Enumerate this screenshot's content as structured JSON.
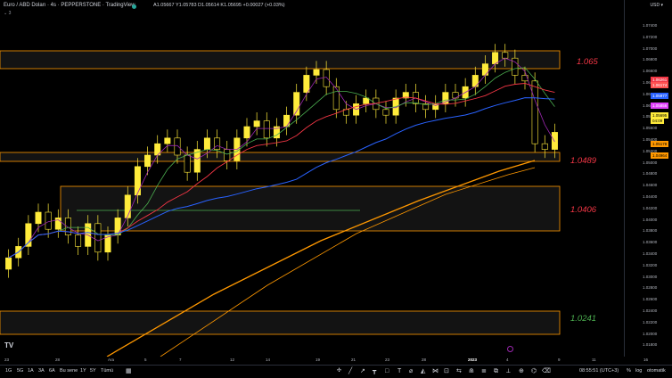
{
  "header": {
    "title": "Euro / ABD Doları · 4s · PEPPERSTONE · TradingView",
    "ohlc": "A1.05667  Y1.05783  D1.05614  K1.05695  +0.00027 (+0.03%)",
    "collapse": "⌄ 3"
  },
  "price_axis": {
    "currency": "USD ▾",
    "ticks": [
      "1.07400",
      "1.07200",
      "1.07000",
      "1.06800",
      "1.06600",
      "1.06400",
      "1.06200",
      "1.06000",
      "1.05800",
      "1.05600",
      "1.05400",
      "1.05200",
      "1.05000",
      "1.04800",
      "1.04600",
      "1.04400",
      "1.04200",
      "1.04000",
      "1.03800",
      "1.03600",
      "1.03400",
      "1.03200",
      "1.03000",
      "1.02800",
      "1.02600",
      "1.02400",
      "1.02200",
      "1.02000",
      "1.01800"
    ],
    "tags": [
      {
        "text": "1.06261",
        "color": "#f23645"
      },
      {
        "text": "1.06174",
        "color": "#ff5252"
      },
      {
        "text": "1.05977",
        "color": "#2962ff"
      },
      {
        "text": "1.05856",
        "color": "#e040fb"
      },
      {
        "text": "1.05695",
        "color": "#ffeb3b"
      },
      {
        "text": "04:09",
        "color": "#ffeb3b"
      },
      {
        "text": "1.05178",
        "color": "#ff9800"
      },
      {
        "text": "1.04964",
        "color": "#ff9800"
      }
    ]
  },
  "zones": [
    {
      "label": "1.065",
      "color": "#f23645"
    },
    {
      "label": "1.0489",
      "color": "#f23645"
    },
    {
      "label": "1.0406",
      "color": "#f23645"
    },
    {
      "label": "1.0241",
      "color": "#4caf50"
    }
  ],
  "time_axis": [
    "23",
    "28",
    "Ara",
    "5",
    "7",
    "12",
    "14",
    "19",
    "21",
    "23",
    "28",
    "2023",
    "4",
    "9",
    "11",
    "16"
  ],
  "toolbar": {
    "timeframes": [
      "1G",
      "5G",
      "1A",
      "3A",
      "6A",
      "Bu sene",
      "1Y",
      "5Y",
      "Tümü"
    ],
    "clock": "08:55:51 (UTC+3)",
    "percent": "%",
    "log": "log",
    "auto": "otomatik"
  },
  "colors": {
    "zone_border": "#ff9800",
    "candle": "#ffeb3b",
    "ema_fast": "#9c27b0",
    "ema_mid": "#4caf50",
    "ema_slow": "#f23645",
    "ma_blue": "#2962ff",
    "ma_orange": "#ff9800"
  },
  "chart_data": {
    "type": "line",
    "ylim": [
      1.017,
      1.0745
    ],
    "series": [
      {
        "values": [
          1.034,
          1.036,
          1.04,
          1.042,
          1.039,
          1.041,
          1.038,
          1.036,
          1.04,
          1.035,
          1.038,
          1.041,
          1.045,
          1.05,
          1.052,
          1.054,
          1.055,
          1.052,
          1.049,
          1.053,
          1.055,
          1.053,
          1.051,
          1.055,
          1.057,
          1.058,
          1.055,
          1.057,
          1.059,
          1.063,
          1.066,
          1.067,
          1.064,
          1.06,
          1.059,
          1.061,
          1.062,
          1.06,
          1.059,
          1.062,
          1.063,
          1.061,
          1.06,
          1.061,
          1.063,
          1.062,
          1.064,
          1.066,
          1.068,
          1.07,
          1.069,
          1.066,
          1.065,
          1.054,
          1.053,
          1.056
        ]
      }
    ]
  }
}
